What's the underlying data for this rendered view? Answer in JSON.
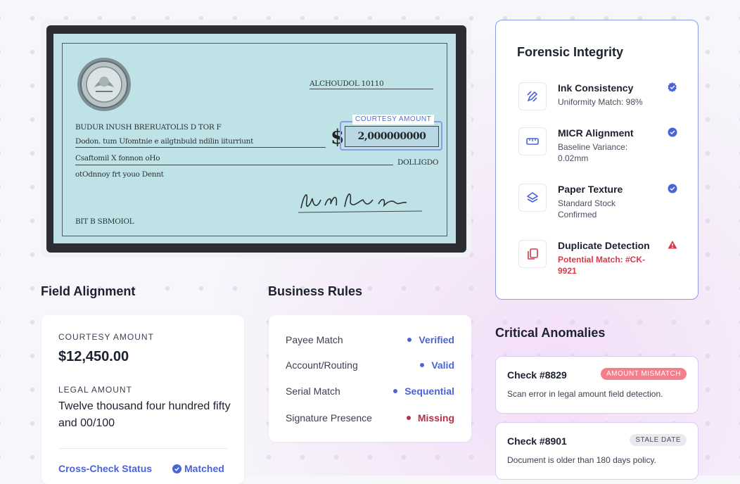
{
  "check": {
    "courtesy_tag": "COURTESY AMOUNT",
    "date_field": "ALCHOUDOL 10110",
    "payee_line1": "BUDUR INUSH BRERUATOLIS D TOR F",
    "payee_line2": "Dodon. tum Ufomtnie e ailgtnbuld ndilin iiturriunt",
    "legal_line": "Csaftomil X fonnon oHo",
    "legal_right": "DOLLIGDO",
    "memo_line": "otOdnnoy frt youo Dennt",
    "bank_line": "BIT B SBMOIOL",
    "amount_text": "2,000000000",
    "dollar_sign": "$"
  },
  "field_alignment": {
    "title": "Field Alignment",
    "courtesy_label": "COURTESY AMOUNT",
    "courtesy_value": "$12,450.00",
    "legal_label": "LEGAL AMOUNT",
    "legal_value": "Twelve thousand four hundred fifty and 00/100",
    "cross_check_label": "Cross-Check Status",
    "cross_check_value": "Matched"
  },
  "business_rules": {
    "title": "Business Rules",
    "rows": [
      {
        "label": "Payee Match",
        "status": "Verified",
        "color": "#4a63d8"
      },
      {
        "label": "Account/Routing",
        "status": "Valid",
        "color": "#4a63d8"
      },
      {
        "label": "Serial Match",
        "status": "Sequential",
        "color": "#4a63d8"
      },
      {
        "label": "Signature Presence",
        "status": "Missing",
        "color": "#b3314a"
      }
    ]
  },
  "forensic": {
    "title": "Forensic Integrity",
    "items": [
      {
        "title": "Ink Consistency",
        "sub": "Uniformity Match: 98%",
        "icon": "pen-icon",
        "badge": "verified-icon"
      },
      {
        "title": "MICR Alignment",
        "sub": "Baseline Variance: 0.02mm",
        "icon": "ruler-icon",
        "badge": "verified-icon"
      },
      {
        "title": "Paper Texture",
        "sub": "Standard Stock Confirmed",
        "icon": "layers-icon",
        "badge": "verified-icon"
      },
      {
        "title": "Duplicate Detection",
        "sub": "Potential Match: #CK-9921",
        "icon": "copy-icon",
        "badge": "warning-icon"
      }
    ]
  },
  "anomalies": {
    "title": "Critical Anomalies",
    "items": [
      {
        "title": "Check #8829",
        "badge": "AMOUNT MISMATCH",
        "desc": "Scan error in legal amount field detection."
      },
      {
        "title": "Check #8901",
        "badge": "STALE DATE",
        "desc": "Document is older than 180 days policy."
      }
    ]
  },
  "colors": {
    "accent": "#4a63d8",
    "danger": "#d93a48",
    "missing": "#b3314a"
  }
}
